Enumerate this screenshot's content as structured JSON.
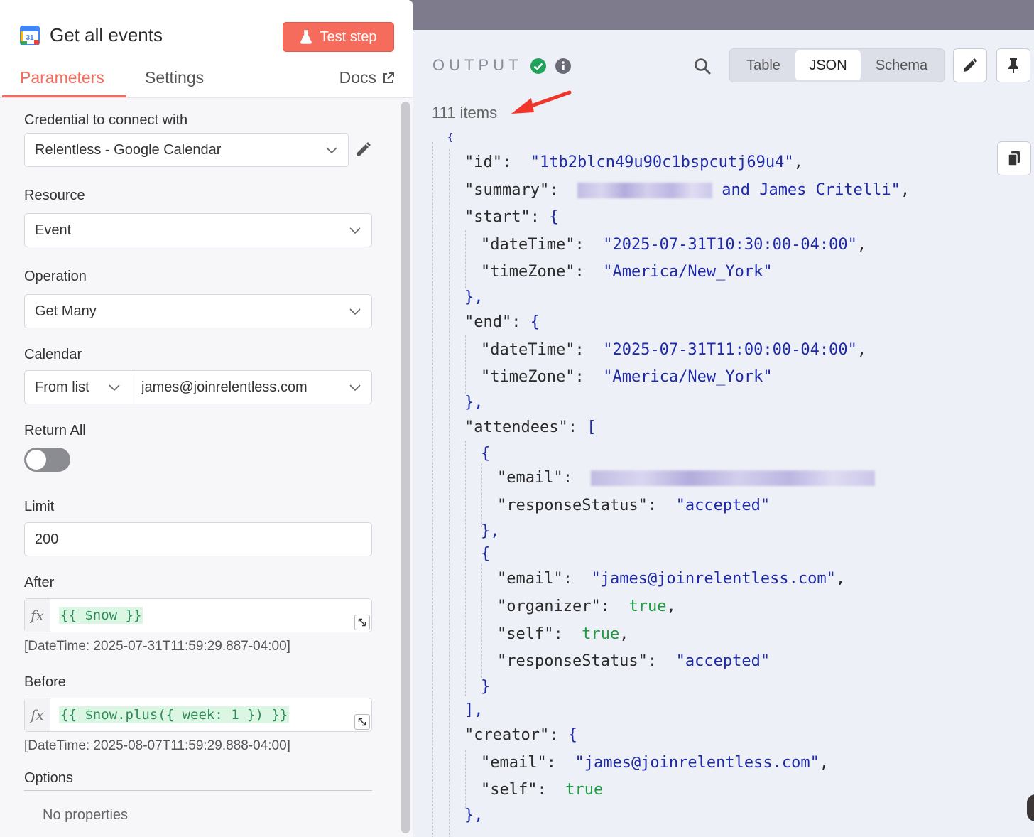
{
  "node": {
    "title": "Get all events",
    "icon": "google-calendar-icon",
    "icon_text": "31",
    "test_button": "Test step"
  },
  "tabs": {
    "parameters": "Parameters",
    "settings": "Settings",
    "docs": "Docs"
  },
  "params": {
    "credential_label": "Credential to connect with",
    "credential_value": "Relentless - Google Calendar",
    "resource_label": "Resource",
    "resource_value": "Event",
    "operation_label": "Operation",
    "operation_value": "Get Many",
    "calendar_label": "Calendar",
    "calendar_mode": "From list",
    "calendar_value": "james@joinrelentless.com",
    "return_all_label": "Return All",
    "return_all": false,
    "limit_label": "Limit",
    "limit_value": "200",
    "after_label": "After",
    "after_expr": "{{ $now }}",
    "after_hint": "[DateTime: 2025-07-31T11:59:29.887-04:00]",
    "before_label": "Before",
    "before_expr": "{{ $now.plus({ week: 1 }) }}",
    "before_hint": "[DateTime: 2025-08-07T11:59:29.888-04:00]",
    "fx": "fx",
    "options_label": "Options",
    "no_properties": "No properties"
  },
  "output": {
    "title": "OUTPUT",
    "views": [
      "Table",
      "JSON",
      "Schema"
    ],
    "active_view": "JSON",
    "items_count": "111 items",
    "accent_color": "#f56c5d"
  },
  "json": {
    "open_brace": "{",
    "id_key": "\"id\"",
    "id_val": "\"1tb2blcn49u90c1bspcutj69u4\"",
    "summary_key": "\"summary\"",
    "summary_val_visible": "and James Critelli\"",
    "start_key": "\"start\"",
    "start_datetime": "\"2025-07-31T10:30:00-04:00\"",
    "timezone": "\"America/New_York\"",
    "datetime_key": "\"dateTime\"",
    "timezone_key": "\"timeZone\"",
    "end_key": "\"end\"",
    "end_datetime": "\"2025-07-31T11:00:00-04:00\"",
    "attendees_key": "\"attendees\"",
    "email_key": "\"email\"",
    "response_key": "\"responseStatus\"",
    "accepted": "\"accepted\"",
    "attendee_email": "\"james@joinrelentless.com\"",
    "organizer_key": "\"organizer\"",
    "self_key": "\"self\"",
    "true_val": "true",
    "creator_key": "\"creator\"",
    "creator_email": "\"james@joinrelentless.com\""
  }
}
